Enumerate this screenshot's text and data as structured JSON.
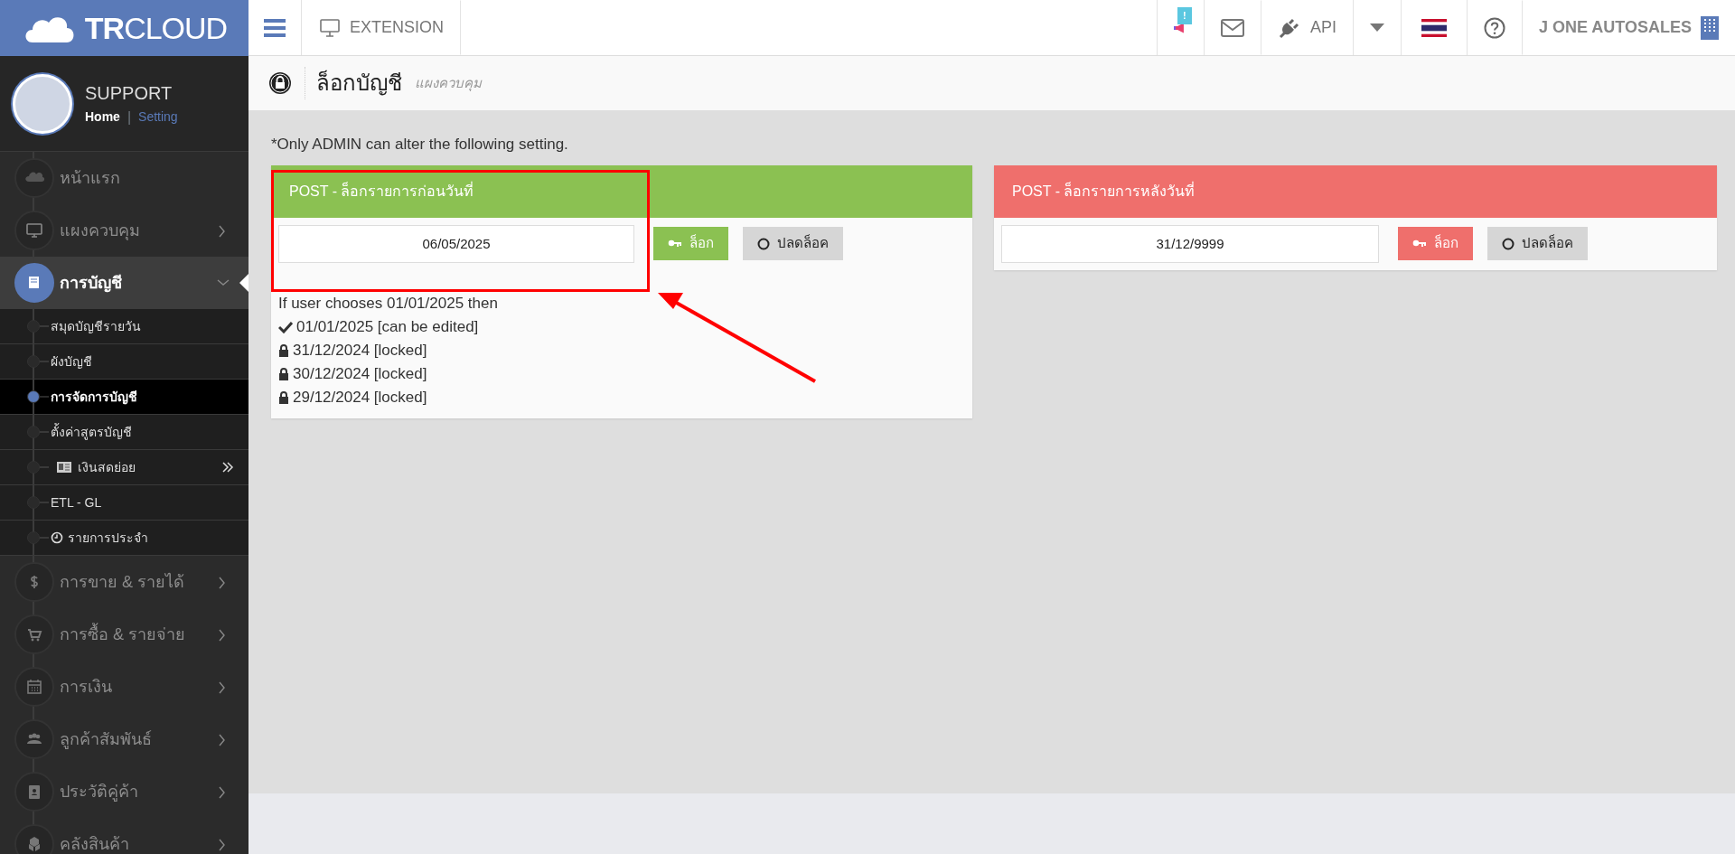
{
  "logo": {
    "text_bold": "TR",
    "text_light": "CLOUD"
  },
  "profile": {
    "name": "SUPPORT",
    "separator": "|",
    "links": [
      {
        "label": "Home",
        "selected": true
      },
      {
        "label": "Setting",
        "selected": false
      }
    ]
  },
  "sidebar": {
    "items": [
      {
        "label": "หน้าแรก",
        "selected": false
      },
      {
        "label": "แผงควบคุม",
        "selected": false,
        "expanded": false
      },
      {
        "label": "การบัญชี",
        "selected": true,
        "expanded": true,
        "children": [
          {
            "label": "สมุดบัญชีรายวัน",
            "selected": false
          },
          {
            "label": "ผังบัญชี",
            "selected": false
          },
          {
            "label": "การจัดการบัญชี",
            "selected": true
          },
          {
            "label": "ตั้งค่าสูตรบัญชี",
            "selected": false
          },
          {
            "label": "เงินสดย่อย",
            "selected": false,
            "expanded": false
          },
          {
            "label": "ETL - GL",
            "selected": false
          },
          {
            "label": "รายการประจำ",
            "selected": false
          }
        ]
      },
      {
        "label": "การขาย & รายได้",
        "selected": false,
        "expanded": false
      },
      {
        "label": "การซื้อ & รายจ่าย",
        "selected": false,
        "expanded": false
      },
      {
        "label": "การเงิน",
        "selected": false,
        "expanded": false
      },
      {
        "label": "ลูกค้าสัมพันธ์",
        "selected": false,
        "expanded": false
      },
      {
        "label": "ประวัติคู่ค้า",
        "selected": false,
        "expanded": false
      },
      {
        "label": "คลังสินค้า",
        "selected": false,
        "expanded": false
      }
    ]
  },
  "topbar": {
    "extension": "EXTENSION",
    "notification_badge": "!",
    "api": "API",
    "company": "J ONE AUTOSALES"
  },
  "page_header": {
    "title": "ล็อกบัญชี",
    "subtitle": "แผงควบคุม"
  },
  "notice": "*Only ADMIN can alter the following setting.",
  "panels": [
    {
      "title": "POST - ล็อกรายการก่อนวันที่",
      "color": "#8bc152",
      "date": "06/05/2025",
      "lock_label": "ล็อก",
      "unlock_label": "ปลดล็อค",
      "notes": [
        {
          "kind": "text",
          "text": "If user chooses 01/01/2025 then"
        },
        {
          "kind": "check",
          "text": "01/01/2025 [can be edited]"
        },
        {
          "kind": "lock",
          "text": "31/12/2024 [locked]"
        },
        {
          "kind": "lock",
          "text": "30/12/2024 [locked]"
        },
        {
          "kind": "lock",
          "text": "29/12/2024 [locked]"
        }
      ]
    },
    {
      "title": "POST - ล็อกรายการหลังวันที่",
      "color": "#ef6f6c",
      "date": "31/12/9999",
      "lock_label": "ล็อก",
      "unlock_label": "ปลดล็อค"
    }
  ]
}
